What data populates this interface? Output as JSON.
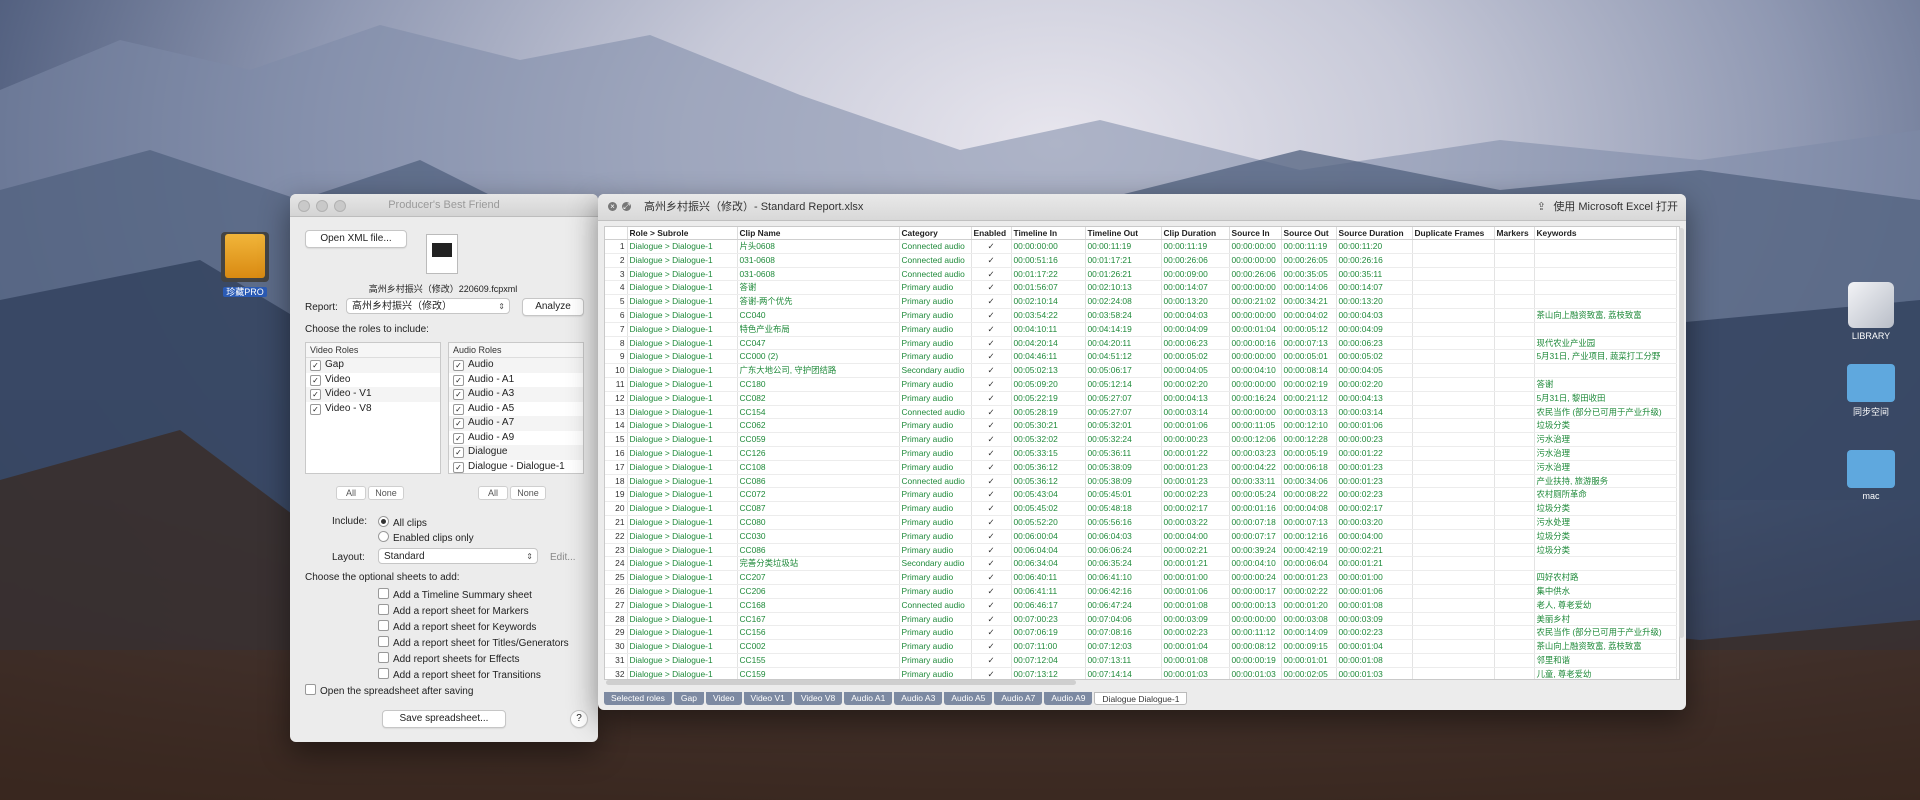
{
  "desktop": {
    "icons": [
      {
        "label": "珍藏PRO",
        "name": "desktop-icon-zhencang-pro",
        "color": "#e8a025"
      },
      {
        "label": "LIBRARY",
        "name": "desktop-icon-library",
        "color": "#cfd3da"
      },
      {
        "label": "同步空间",
        "name": "desktop-icon-sync-space",
        "color": "#5fa8de"
      },
      {
        "label": "mac",
        "name": "desktop-icon-mac",
        "color": "#5fa8de"
      }
    ]
  },
  "pbf": {
    "title": "Producer's Best Friend",
    "open_xml_label": "Open XML file...",
    "file_name": "高州乡村振兴（修改）220609.fcpxml",
    "report_label": "Report:",
    "report_value": "高州乡村振兴（修改）",
    "analyze_label": "Analyze",
    "choose_roles_label": "Choose the roles to include:",
    "video_roles_header": "Video Roles",
    "audio_roles_header": "Audio Roles",
    "video_roles": [
      "Gap",
      "Video",
      "Video - V1",
      "Video - V8"
    ],
    "audio_roles": [
      "Audio",
      "Audio - A1",
      "Audio - A3",
      "Audio - A5",
      "Audio - A7",
      "Audio - A9",
      "Dialogue",
      "Dialogue - Dialogue-1"
    ],
    "all_label": "All",
    "none_label": "None",
    "include_label": "Include:",
    "include_all": "All clips",
    "include_enabled": "Enabled clips only",
    "layout_label": "Layout:",
    "layout_value": "Standard",
    "edit_label": "Edit...",
    "optional_label": "Choose the optional sheets to add:",
    "optional_sheets": [
      "Add a Timeline Summary sheet",
      "Add a report sheet for Markers",
      "Add a report sheet for Keywords",
      "Add a report sheet for Titles/Generators",
      "Add report sheets for Effects",
      "Add a report sheet for Transitions"
    ],
    "open_after_label": "Open the spreadsheet after saving",
    "save_label": "Save spreadsheet...",
    "help_label": "?"
  },
  "xl": {
    "title": "高州乡村振兴（修改）- Standard Report.xlsx",
    "open_in_excel": "使用 Microsoft Excel 打开",
    "columns": [
      "",
      "Role > Subrole",
      "Clip Name",
      "Category",
      "Enabled",
      "Timeline In",
      "Timeline Out",
      "Clip Duration",
      "Source In",
      "Source Out",
      "Source Duration",
      "Duplicate Frames",
      "Markers",
      "Keywords"
    ],
    "rows": [
      [
        "1",
        "Dialogue > Dialogue-1",
        "片头0608",
        "Connected audio",
        "✓",
        "00:00:00:00",
        "00:00:11:19",
        "00:00:11:19",
        "00:00:00:00",
        "00:00:11:19",
        "00:00:11:20",
        "",
        "",
        ""
      ],
      [
        "2",
        "Dialogue > Dialogue-1",
        "031-0608",
        "Connected audio",
        "✓",
        "00:00:51:16",
        "00:01:17:21",
        "00:00:26:06",
        "00:00:00:00",
        "00:00:26:05",
        "00:00:26:16",
        "",
        "",
        ""
      ],
      [
        "3",
        "Dialogue > Dialogue-1",
        "031-0608",
        "Connected audio",
        "✓",
        "00:01:17:22",
        "00:01:26:21",
        "00:00:09:00",
        "00:00:26:06",
        "00:00:35:05",
        "00:00:35:11",
        "",
        "",
        ""
      ],
      [
        "4",
        "Dialogue > Dialogue-1",
        "答谢",
        "Primary audio",
        "✓",
        "00:01:56:07",
        "00:02:10:13",
        "00:00:14:07",
        "00:00:00:00",
        "00:00:14:06",
        "00:00:14:07",
        "",
        "",
        ""
      ],
      [
        "5",
        "Dialogue > Dialogue-1",
        "答谢-两个优先",
        "Primary audio",
        "✓",
        "00:02:10:14",
        "00:02:24:08",
        "00:00:13:20",
        "00:00:21:02",
        "00:00:34:21",
        "00:00:13:20",
        "",
        "",
        ""
      ],
      [
        "6",
        "Dialogue > Dialogue-1",
        "CC040",
        "Primary audio",
        "✓",
        "00:03:54:22",
        "00:03:58:24",
        "00:00:04:03",
        "00:00:00:00",
        "00:00:04:02",
        "00:00:04:03",
        "",
        "",
        "茶山向上融资致富, 荔枝致富"
      ],
      [
        "7",
        "Dialogue > Dialogue-1",
        "特色产业布局",
        "Primary audio",
        "✓",
        "00:04:10:11",
        "00:04:14:19",
        "00:00:04:09",
        "00:00:01:04",
        "00:00:05:12",
        "00:00:04:09",
        "",
        "",
        ""
      ],
      [
        "8",
        "Dialogue > Dialogue-1",
        "CC047",
        "Primary audio",
        "✓",
        "00:04:20:14",
        "00:04:20:11",
        "00:00:06:23",
        "00:00:00:16",
        "00:00:07:13",
        "00:00:06:23",
        "",
        "",
        "现代农业产业园"
      ],
      [
        "9",
        "Dialogue > Dialogue-1",
        "CC000 (2)",
        "Primary audio",
        "✓",
        "00:04:46:11",
        "00:04:51:12",
        "00:00:05:02",
        "00:00:00:00",
        "00:00:05:01",
        "00:00:05:02",
        "",
        "",
        "5月31日, 产业项目, 蔬菜打工分野"
      ],
      [
        "10",
        "Dialogue > Dialogue-1",
        "广东大地公司, 守护团结路",
        "Secondary audio",
        "✓",
        "00:05:02:13",
        "00:05:06:17",
        "00:00:04:05",
        "00:00:04:10",
        "00:00:08:14",
        "00:00:04:05",
        "",
        "",
        ""
      ],
      [
        "11",
        "Dialogue > Dialogue-1",
        "CC180",
        "Primary audio",
        "✓",
        "00:05:09:20",
        "00:05:12:14",
        "00:00:02:20",
        "00:00:00:00",
        "00:00:02:19",
        "00:00:02:20",
        "",
        "",
        "答谢"
      ],
      [
        "12",
        "Dialogue > Dialogue-1",
        "CC082",
        "Primary audio",
        "✓",
        "00:05:22:19",
        "00:05:27:07",
        "00:00:04:13",
        "00:00:16:24",
        "00:00:21:12",
        "00:00:04:13",
        "",
        "",
        "5月31日, 黎田收田"
      ],
      [
        "13",
        "Dialogue > Dialogue-1",
        "CC154",
        "Connected audio",
        "✓",
        "00:05:28:19",
        "00:05:27:07",
        "00:00:03:14",
        "00:00:00:00",
        "00:00:03:13",
        "00:00:03:14",
        "",
        "",
        "农民当作 (部分已可用于产业升级)"
      ],
      [
        "14",
        "Dialogue > Dialogue-1",
        "CC062",
        "Primary audio",
        "✓",
        "00:05:30:21",
        "00:05:32:01",
        "00:00:01:06",
        "00:00:11:05",
        "00:00:12:10",
        "00:00:01:06",
        "",
        "",
        "垃圾分类"
      ],
      [
        "15",
        "Dialogue > Dialogue-1",
        "CC059",
        "Primary audio",
        "✓",
        "00:05:32:02",
        "00:05:32:24",
        "00:00:00:23",
        "00:00:12:06",
        "00:00:12:28",
        "00:00:00:23",
        "",
        "",
        "污水治理"
      ],
      [
        "16",
        "Dialogue > Dialogue-1",
        "CC126",
        "Primary audio",
        "✓",
        "00:05:33:15",
        "00:05:36:11",
        "00:00:01:22",
        "00:00:03:23",
        "00:00:05:19",
        "00:00:01:22",
        "",
        "",
        "污水治理"
      ],
      [
        "17",
        "Dialogue > Dialogue-1",
        "CC108",
        "Primary audio",
        "✓",
        "00:05:36:12",
        "00:05:38:09",
        "00:00:01:23",
        "00:00:04:22",
        "00:00:06:18",
        "00:00:01:23",
        "",
        "",
        "污水治理"
      ],
      [
        "18",
        "Dialogue > Dialogue-1",
        "CC086",
        "Connected audio",
        "✓",
        "00:05:36:12",
        "00:05:38:09",
        "00:00:01:23",
        "00:00:33:11",
        "00:00:34:06",
        "00:00:01:23",
        "",
        "",
        "产业扶持, 旅游服务"
      ],
      [
        "19",
        "Dialogue > Dialogue-1",
        "CC072",
        "Primary audio",
        "✓",
        "00:05:43:04",
        "00:05:45:01",
        "00:00:02:23",
        "00:00:05:24",
        "00:00:08:22",
        "00:00:02:23",
        "",
        "",
        "农村厕所革命"
      ],
      [
        "20",
        "Dialogue > Dialogue-1",
        "CC087",
        "Primary audio",
        "✓",
        "00:05:45:02",
        "00:05:48:18",
        "00:00:02:17",
        "00:00:01:16",
        "00:00:04:08",
        "00:00:02:17",
        "",
        "",
        "垃圾分类"
      ],
      [
        "21",
        "Dialogue > Dialogue-1",
        "CC080",
        "Primary audio",
        "✓",
        "00:05:52:20",
        "00:05:56:16",
        "00:00:03:22",
        "00:00:07:18",
        "00:00:07:13",
        "00:00:03:20",
        "",
        "",
        "污水处理"
      ],
      [
        "22",
        "Dialogue > Dialogue-1",
        "CC030",
        "Primary audio",
        "✓",
        "00:06:00:04",
        "00:06:04:03",
        "00:00:04:00",
        "00:00:07:17",
        "00:00:12:16",
        "00:00:04:00",
        "",
        "",
        "垃圾分类"
      ],
      [
        "23",
        "Dialogue > Dialogue-1",
        "CC086",
        "Primary audio",
        "✓",
        "00:06:04:04",
        "00:06:06:24",
        "00:00:02:21",
        "00:00:39:24",
        "00:00:42:19",
        "00:00:02:21",
        "",
        "",
        "垃圾分类"
      ],
      [
        "24",
        "Dialogue > Dialogue-1",
        "完善分类垃圾站",
        "Secondary audio",
        "✓",
        "00:06:34:04",
        "00:06:35:24",
        "00:00:01:21",
        "00:00:04:10",
        "00:00:06:04",
        "00:00:01:21",
        "",
        "",
        ""
      ],
      [
        "25",
        "Dialogue > Dialogue-1",
        "CC207",
        "Primary audio",
        "✓",
        "00:06:40:11",
        "00:06:41:10",
        "00:00:01:00",
        "00:00:00:24",
        "00:00:01:23",
        "00:00:01:00",
        "",
        "",
        "四好农村路"
      ],
      [
        "26",
        "Dialogue > Dialogue-1",
        "CC206",
        "Primary audio",
        "✓",
        "00:06:41:11",
        "00:06:42:16",
        "00:00:01:06",
        "00:00:00:17",
        "00:00:02:22",
        "00:00:01:06",
        "",
        "",
        "集中供水"
      ],
      [
        "27",
        "Dialogue > Dialogue-1",
        "CC168",
        "Connected audio",
        "✓",
        "00:06:46:17",
        "00:06:47:24",
        "00:00:01:08",
        "00:00:00:13",
        "00:00:01:20",
        "00:00:01:08",
        "",
        "",
        "老人, 尊老爱幼"
      ],
      [
        "28",
        "Dialogue > Dialogue-1",
        "CC167",
        "Primary audio",
        "✓",
        "00:07:00:23",
        "00:07:04:06",
        "00:00:03:09",
        "00:00:00:00",
        "00:00:03:08",
        "00:00:03:09",
        "",
        "",
        "美丽乡村"
      ],
      [
        "29",
        "Dialogue > Dialogue-1",
        "CC156",
        "Primary audio",
        "✓",
        "00:07:06:19",
        "00:07:08:16",
        "00:00:02:23",
        "00:00:11:12",
        "00:00:14:09",
        "00:00:02:23",
        "",
        "",
        "农民当作 (部分已可用于产业升级)"
      ],
      [
        "30",
        "Dialogue > Dialogue-1",
        "CC002",
        "Primary audio",
        "✓",
        "00:07:11:00",
        "00:07:12:03",
        "00:00:01:04",
        "00:00:08:12",
        "00:00:09:15",
        "00:00:01:04",
        "",
        "",
        "茶山向上融资致富, 荔枝致富"
      ],
      [
        "31",
        "Dialogue > Dialogue-1",
        "CC155",
        "Primary audio",
        "✓",
        "00:07:12:04",
        "00:07:13:11",
        "00:00:01:08",
        "00:00:00:19",
        "00:00:01:01",
        "00:00:01:08",
        "",
        "",
        "邻里和谐"
      ],
      [
        "32",
        "Dialogue > Dialogue-1",
        "CC159",
        "Primary audio",
        "✓",
        "00:07:13:12",
        "00:07:14:14",
        "00:00:01:03",
        "00:00:01:03",
        "00:00:02:05",
        "00:00:01:03",
        "",
        "",
        "儿童, 尊老爱幼"
      ],
      [
        "33",
        "Dialogue > Dialogue-1",
        "CC039",
        "Primary audio",
        "✓",
        "00:07:15:24",
        "00:07:17:23",
        "00:00:02:00",
        "00:00:01:00",
        "00:00:02:24",
        "00:00:02:00",
        "",
        "",
        "邻里和谐"
      ],
      [
        "34",
        "Dialogue > Dialogue-1",
        "CC045",
        "Primary audio",
        "✓",
        "00:07:29:07",
        "00:07:32:20",
        "00:00:03:14",
        "00:00:04:01",
        "00:00:07:14",
        "00:00:03:14",
        "",
        "",
        "茶山向上融资致富, 荔枝致富"
      ]
    ],
    "tabs": [
      "Selected roles",
      "Gap",
      "Video",
      "Video   V1",
      "Video   V8",
      "Audio   A1",
      "Audio   A3",
      "Audio   A5",
      "Audio   A7",
      "Audio   A9",
      "Dialogue   Dialogue-1"
    ],
    "active_tab": 10
  }
}
